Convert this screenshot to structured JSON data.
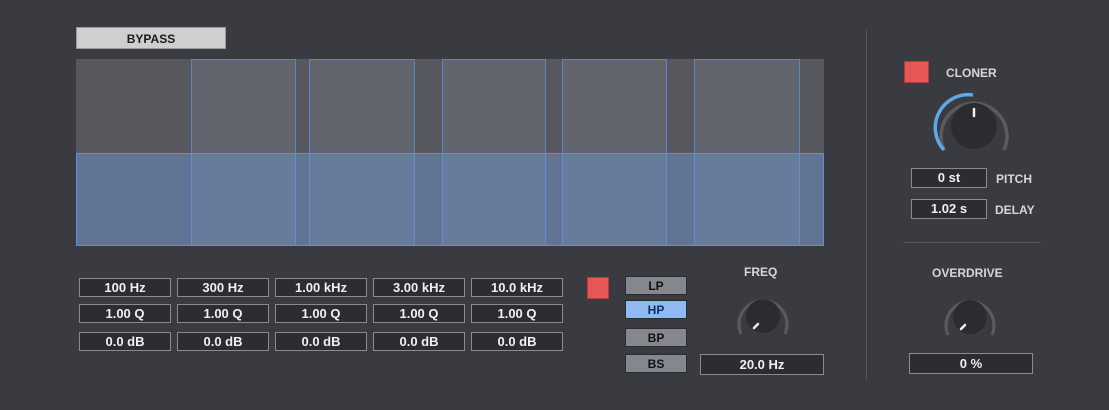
{
  "bypass_label": "BYPASS",
  "bands": [
    {
      "freq": "100 Hz",
      "q": "1.00 Q",
      "gain": "0.0 dB"
    },
    {
      "freq": "300 Hz",
      "q": "1.00 Q",
      "gain": "0.0 dB"
    },
    {
      "freq": "1.00 kHz",
      "q": "1.00 Q",
      "gain": "0.0 dB"
    },
    {
      "freq": "3.00 kHz",
      "q": "1.00 Q",
      "gain": "0.0 dB"
    },
    {
      "freq": "10.0 kHz",
      "q": "1.00 Q",
      "gain": "0.0 dB"
    }
  ],
  "filter": {
    "types": [
      "LP",
      "HP",
      "BP",
      "BS"
    ],
    "selected": "HP",
    "freq_label": "FREQ",
    "freq_value": "20.0 Hz"
  },
  "cloner": {
    "label": "CLONER",
    "pitch_value": "0 st",
    "pitch_label": "PITCH",
    "delay_value": "1.02 s",
    "delay_label": "DELAY"
  },
  "overdrive": {
    "label": "OVERDRIVE",
    "value": "0 %"
  },
  "colors": {
    "background": "#3a3b40",
    "accent_blue": "#5e8fe0",
    "toggle_red": "#e55654",
    "selected_filter": "#8fbbf2"
  }
}
